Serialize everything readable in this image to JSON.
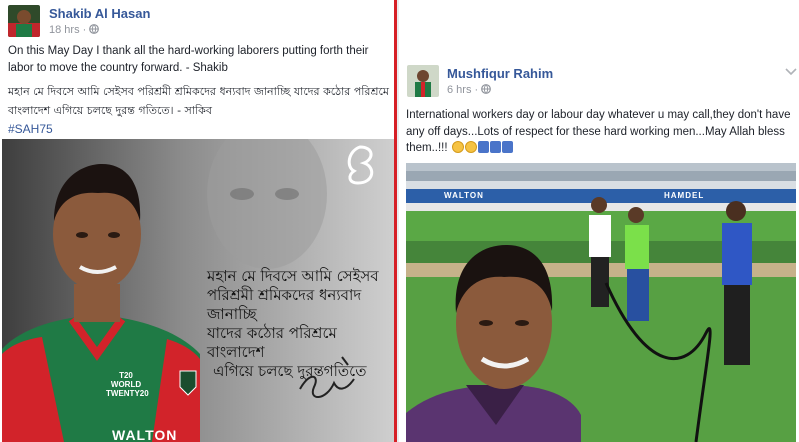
{
  "left_post": {
    "author": "Shakib Al Hasan",
    "time": "18 hrs",
    "separator": "·",
    "text_en": "On this May Day I thank all the hard-working laborers putting forth their labor to move the country forward. - Shakib",
    "text_bn": "মহান মে দিবসে আমি সেইসব পরিশ্রমী শ্রমিকদের ধন্যবাদ জানাচ্ছি যাদের কঠোর পরিশ্রমে বাংলাদেশ এগিয়ে চলছে দুরন্ত গতিতে। - সাকিব",
    "hashtag": "#SAH75",
    "overlay_lines": [
      "মহান মে দিবসে আমি সেইসব",
      "পরিশ্রমী শ্রমিকদের ধন্যবাদ জানাচ্ছি",
      "যাদের কঠোর পরিশ্রমে বাংলাদেশ",
      "এগিয়ে চলছে দুরন্তগতিতে"
    ],
    "signature": "Shakib",
    "jersey_text": "T20 WORLD TWENTY20",
    "jersey_bottom": "WALTON"
  },
  "right_post": {
    "author": "Mushfiqur Rahim",
    "time": "6 hrs",
    "separator": "·",
    "text": "International workers day or labour day whatever u may call,they don't have any off days...Lots of respect for these hard working men...May Allah bless them..!!!",
    "board_text": "WALTON",
    "board_text2": "HAMDEL"
  },
  "colors": {
    "link": "#365899",
    "meta": "#90949c",
    "divider_red": "#d61f26",
    "jersey_green": "#1f7a45",
    "jersey_red": "#d2232a",
    "grass": "#4f9a3a"
  }
}
